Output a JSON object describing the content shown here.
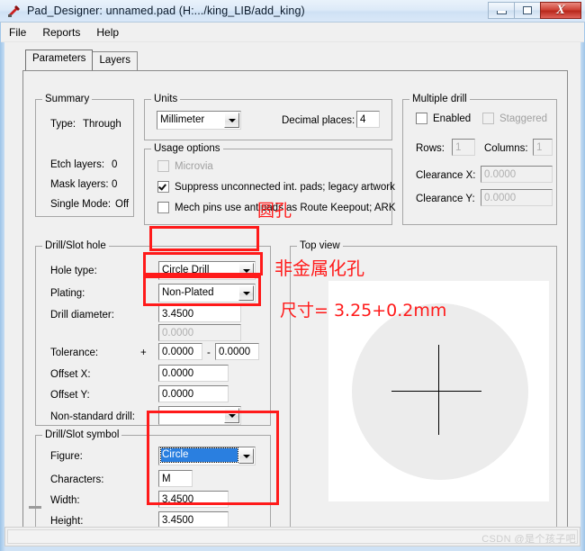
{
  "window": {
    "title": "Pad_Designer: unnamed.pad (H:.../king_LIB/add_king)",
    "app_icon": "pad-designer-icon",
    "buttons": {
      "minimize": "minimize-icon",
      "maximize": "maximize-icon",
      "close": "X"
    }
  },
  "menubar": {
    "items": [
      {
        "label": "File"
      },
      {
        "label": "Reports"
      },
      {
        "label": "Help"
      }
    ]
  },
  "tabs": [
    {
      "label": "Parameters",
      "active": true
    },
    {
      "label": "Layers",
      "active": false
    }
  ],
  "summary": {
    "caption": "Summary",
    "rows": [
      {
        "label": "Type:",
        "value": "Through"
      },
      {
        "label": "Etch layers:",
        "value": "0"
      },
      {
        "label": "Mask layers:",
        "value": "0"
      },
      {
        "label": "Single Mode:",
        "value": "Off"
      }
    ]
  },
  "units": {
    "caption": "Units",
    "unit_value": "Millimeter",
    "decimal_places_label": "Decimal places:",
    "decimal_places_value": "4"
  },
  "usage_options": {
    "caption": "Usage options",
    "items": [
      {
        "label": "Microvia",
        "checked": false,
        "enabled": false
      },
      {
        "label": "Suppress unconnected int. pads; legacy artwork",
        "checked": true,
        "enabled": true
      },
      {
        "label": "Mech pins use antipads as Route Keepout; ARK",
        "checked": false,
        "enabled": true
      }
    ]
  },
  "multiple_drill": {
    "caption": "Multiple drill",
    "enabled_label": "Enabled",
    "enabled_checked": false,
    "staggered_label": "Staggered",
    "staggered_checked": false,
    "rows_label": "Rows:",
    "rows_value": "1",
    "columns_label": "Columns:",
    "columns_value": "1",
    "clearance_x_label": "Clearance X:",
    "clearance_x_value": "0.0000",
    "clearance_y_label": "Clearance Y:",
    "clearance_y_value": "0.0000"
  },
  "drill_slot_hole": {
    "caption": "Drill/Slot hole",
    "hole_type_label": "Hole type:",
    "hole_type_value": "Circle Drill",
    "plating_label": "Plating:",
    "plating_value": "Non-Plated",
    "drill_diameter_label": "Drill diameter:",
    "drill_diameter_value": "3.4500",
    "drill_diameter_second_value": "0.0000",
    "tolerance_label": "Tolerance:",
    "tolerance_plus_sign": "+",
    "tolerance_plus_value": "0.0000",
    "tolerance_minus_sign": "-",
    "tolerance_minus_value": "0.0000",
    "offset_x_label": "Offset X:",
    "offset_x_value": "0.0000",
    "offset_y_label": "Offset Y:",
    "offset_y_value": "0.0000",
    "non_standard_drill_label": "Non-standard drill:",
    "non_standard_drill_value": ""
  },
  "drill_slot_symbol": {
    "caption": "Drill/Slot symbol",
    "figure_label": "Figure:",
    "figure_value": "Circle",
    "characters_label": "Characters:",
    "characters_value": "M",
    "width_label": "Width:",
    "width_value": "3.4500",
    "height_label": "Height:",
    "height_value": "3.4500"
  },
  "top_view": {
    "caption": "Top view",
    "shapes": {
      "pad": "pad-circle",
      "crosshair": "crosshair-icon"
    }
  },
  "annotations": {
    "round_hole": "圆孔",
    "non_plated_hole": "非金属化孔",
    "size_note": "尺寸= 3.25+0.2mm"
  },
  "statusbar": {
    "watermark": "CSDN @是个孩子吧"
  },
  "colors": {
    "annotation_red": "#ff1a1a",
    "selection_blue": "#2a7fe0",
    "window_frame": "#9dc4e8",
    "face": "#f0f0f0"
  }
}
